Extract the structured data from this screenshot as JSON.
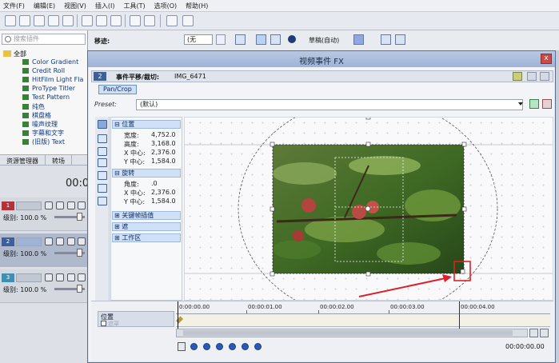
{
  "menu": [
    "文件(F)",
    "编辑(E)",
    "视图(V)",
    "插入(I)",
    "工具(T)",
    "选项(O)",
    "帮助(H)"
  ],
  "toolbar": {
    "track_label": "移迹:",
    "zoom_select": "(无",
    "mode_label": "草稿(自动)"
  },
  "explorer": {
    "search_placeholder": "搜索插件",
    "root": "全部",
    "items": [
      "Color Gradient",
      "Credit Roll",
      "HitFilm Light Fla",
      "ProType Titler",
      "Test Pattern",
      "纯色",
      "棋盘格",
      "噪声纹理",
      "字幕和文字",
      "(旧版) Text"
    ],
    "tabs": [
      "资源管理器",
      "转场"
    ]
  },
  "timecode_bg": "00:0",
  "tracks": [
    {
      "num": "1",
      "level": "级别: 100.0 %"
    },
    {
      "num": "2",
      "level": "级别: 100.0 %"
    },
    {
      "num": "3",
      "level": "级别: 100.0 %"
    }
  ],
  "fx": {
    "title": "视频事件 FX",
    "close": "x",
    "chain_badge": "2",
    "chain_label": "事件平移/裁切:",
    "chain_file": "IMG_6471",
    "tab": "Pan/Crop",
    "preset_label": "Preset:",
    "preset_value": "(默认)",
    "sections": {
      "position": "位置",
      "rotation": "旋转",
      "keyframe": "关键帧插值",
      "mask": "遮",
      "workspace": "工作区"
    },
    "position_props": [
      {
        "label": "宽度:",
        "value": "4,752.0"
      },
      {
        "label": "高度:",
        "value": "3,168.0"
      },
      {
        "label": "X 中心:",
        "value": "2,376.0"
      },
      {
        "label": "Y 中心:",
        "value": "1,584.0"
      }
    ],
    "rotation_props": [
      {
        "label": "角度:",
        "value": ".0"
      },
      {
        "label": "X 中心:",
        "value": "2,376.0"
      },
      {
        "label": "Y 中心:",
        "value": "1,584.0"
      }
    ],
    "timeline": {
      "label": "位置",
      "sublabel": "遮罩",
      "ticks": [
        "0:00:00.00",
        "00:00:01.00",
        "00:00:02.00",
        "00:00:03.00",
        "00:00:04.00"
      ],
      "time": "00:00:00.00"
    }
  },
  "colors": {
    "title_bar": "#a8bbdc",
    "section": "#cfe0f7",
    "highlight_box": "#e02020",
    "arrow": "#d9232b"
  }
}
